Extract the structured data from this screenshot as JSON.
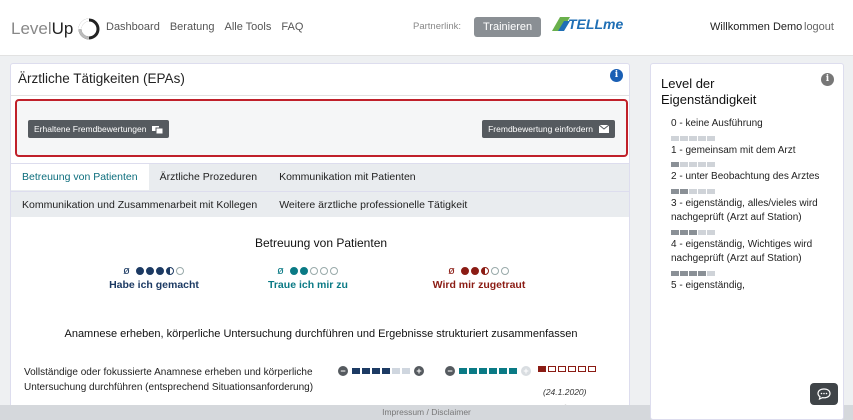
{
  "nav": {
    "logo_light": "Level",
    "logo_dark": "Up",
    "links": [
      "Dashboard",
      "Beratung",
      "Alle Tools",
      "FAQ"
    ],
    "partner_label": "Partnerlink:",
    "partner_button": "Trainieren",
    "partner_logo": "TELLme",
    "welcome": "Willkommen Demo",
    "logout": "logout"
  },
  "main": {
    "title": "Ärztliche Tätigkeiten (EPAs)",
    "info_icon": "i",
    "received_button": "Erhaltene Fremdbewertungen",
    "request_button": "Fremdbewertung einfordern",
    "tabs_row1": [
      "Betreuung von Patienten",
      "Ärztliche Prozeduren",
      "Kommunikation mit Patienten"
    ],
    "tabs_row2": [
      "Kommunikation und Zusammenarbeit mit Kollegen",
      "Weitere ärztliche professionelle Tätigkeit"
    ],
    "active_tab": "Betreuung von Patienten",
    "section_title": "Betreuung von Patienten",
    "legend": [
      {
        "label": "Habe ich gemacht",
        "symbol": "ø",
        "filled": 3,
        "half": 1,
        "color": "#1c3a63"
      },
      {
        "label": "Traue ich mir zu",
        "symbol": "ø",
        "filled": 2,
        "half": 0,
        "color": "#0a7a85"
      },
      {
        "label": "Wird mir zugetraut",
        "symbol": "ø",
        "filled": 2,
        "half": 1,
        "color": "#8b1c14"
      }
    ],
    "activity_heading": "Anamnese erheben, körperliche Untersuchung durchführen und Ergebnisse strukturiert zusammenfassen",
    "item": {
      "text": "Vollständige oder fokussierte Anamnese erheben und körperliche Untersuchung durchführen (entsprechend Situationsanforderung)",
      "done_level": 4,
      "trust_level": 5,
      "assigned_level": 1,
      "assigned_date": "(24.1.2020)",
      "add": "+"
    }
  },
  "footer": "Impressum / Disclaimer",
  "sidebar": {
    "title": "Level der Eigenständigkeit",
    "levels": [
      {
        "text": "0 - keine Ausführung",
        "bars": 0
      },
      {
        "text": "1 - gemeinsam mit dem Arzt",
        "bars": 1
      },
      {
        "text": "2 - unter Beobachtung des Arztes",
        "bars": 2
      },
      {
        "text": "3 - eigenständig, alles/vieles wird nachgeprüft (Arzt auf Station)",
        "bars": 3
      },
      {
        "text": "4 - eigenständig, Wichtiges wird nachgeprüft (Arzt auf Station)",
        "bars": 4
      },
      {
        "text": "5 - eigenständig,",
        "bars": 5
      }
    ]
  },
  "colors": {
    "accent_red": "#c0202a",
    "tab_active": "#0d6e7d",
    "dark_button": "#555a5f"
  }
}
